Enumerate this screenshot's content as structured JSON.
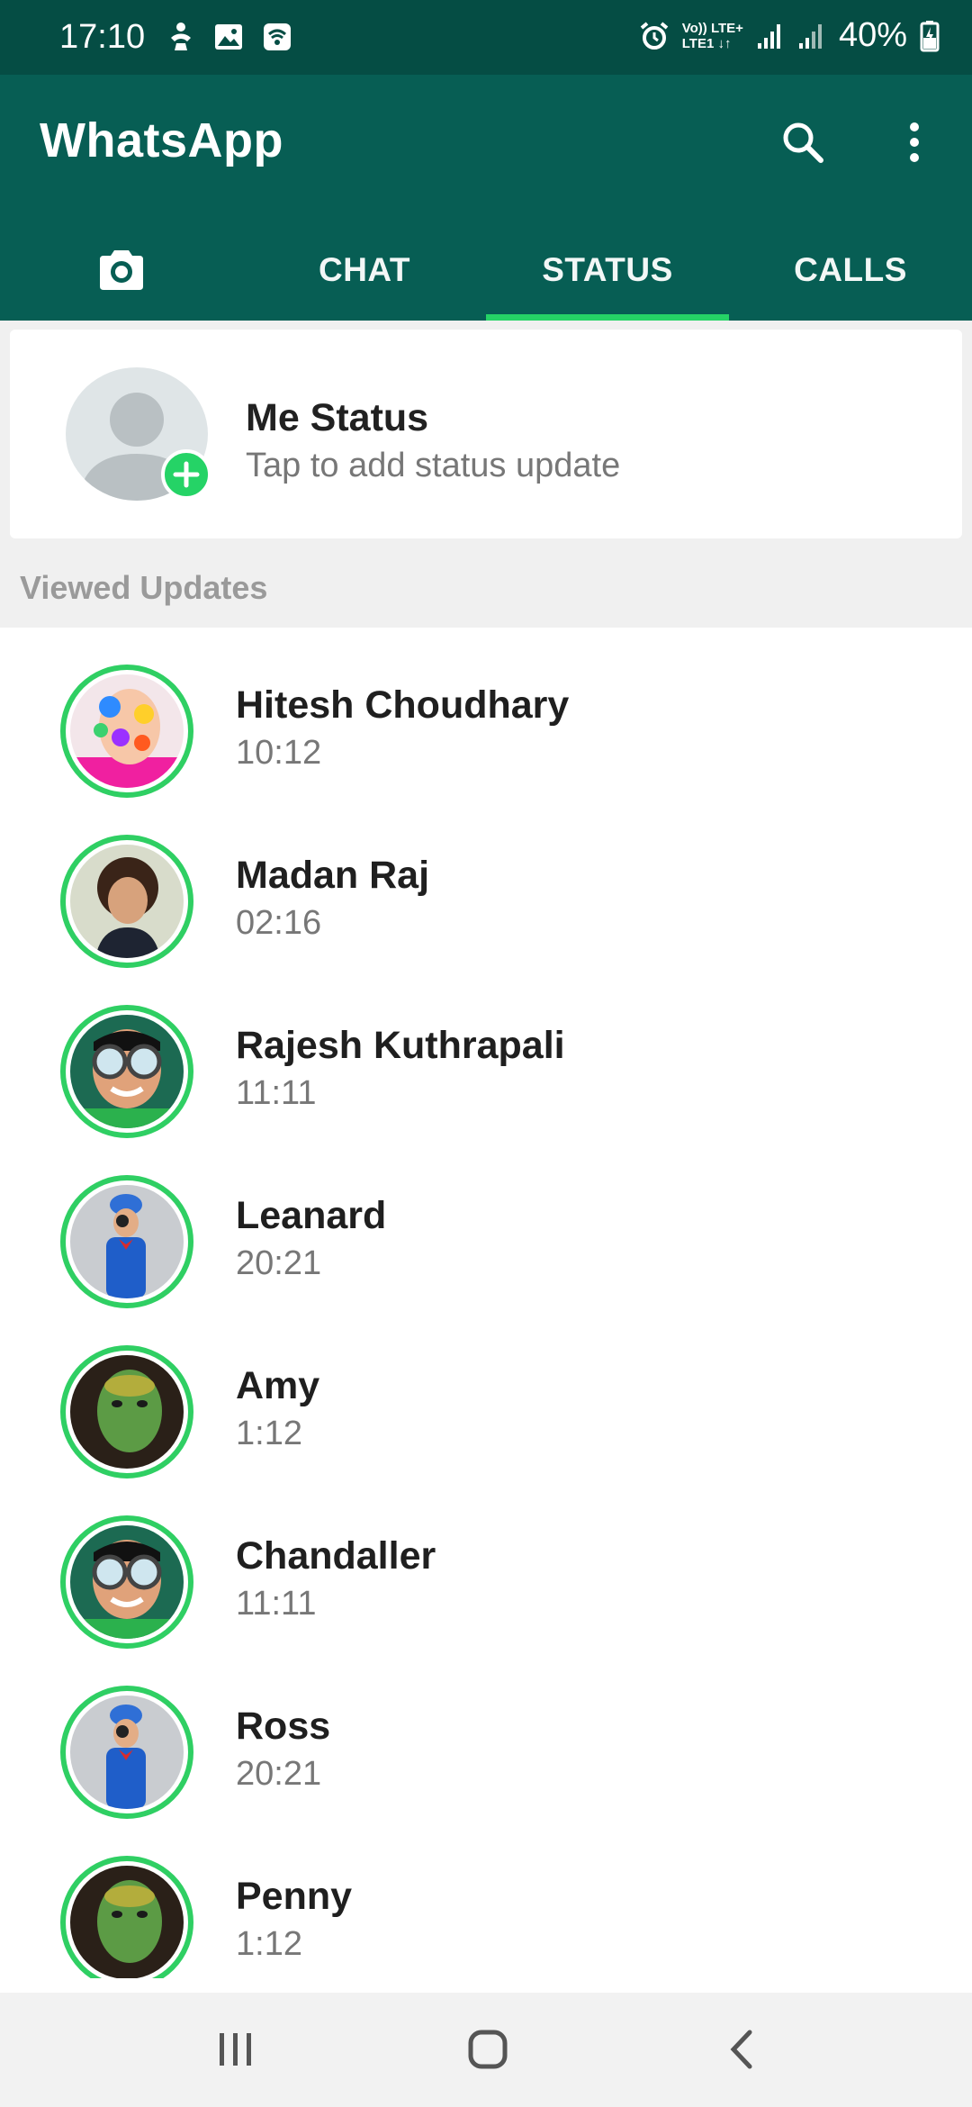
{
  "status_bar": {
    "time": "17:10",
    "network_line1": "Vo)) LTE+",
    "network_line2": "LTE1 ↓↑",
    "battery": "40%"
  },
  "app_bar": {
    "title": "WhatsApp",
    "tabs": [
      {
        "label": "",
        "icon": "camera-icon",
        "active": false
      },
      {
        "label": "CHAT",
        "active": false
      },
      {
        "label": "STATUS",
        "active": true
      },
      {
        "label": "CALLS",
        "active": false
      }
    ]
  },
  "me_status": {
    "name": "Me Status",
    "subtitle": "Tap to add status update"
  },
  "section_label": "Viewed Updates",
  "updates": [
    {
      "name": "Hitesh Choudhary",
      "time": "10:12",
      "photo": "colorful-face"
    },
    {
      "name": "Madan Raj",
      "time": "02:16",
      "photo": "child-curly"
    },
    {
      "name": "Rajesh Kuthrapali",
      "time": "11:11",
      "photo": "goggles-boy"
    },
    {
      "name": "Leanard",
      "time": "20:21",
      "photo": "blue-suit-boy"
    },
    {
      "name": "Amy",
      "time": "1:12",
      "photo": "holi-boy"
    },
    {
      "name": "Chandaller",
      "time": "11:11",
      "photo": "goggles-boy"
    },
    {
      "name": "Ross",
      "time": "20:21",
      "photo": "blue-suit-boy"
    },
    {
      "name": "Penny",
      "time": "1:12",
      "photo": "holi-boy"
    }
  ],
  "colors": {
    "status_bar": "#054d44",
    "app_bar": "#075e54",
    "accent": "#25d366"
  }
}
